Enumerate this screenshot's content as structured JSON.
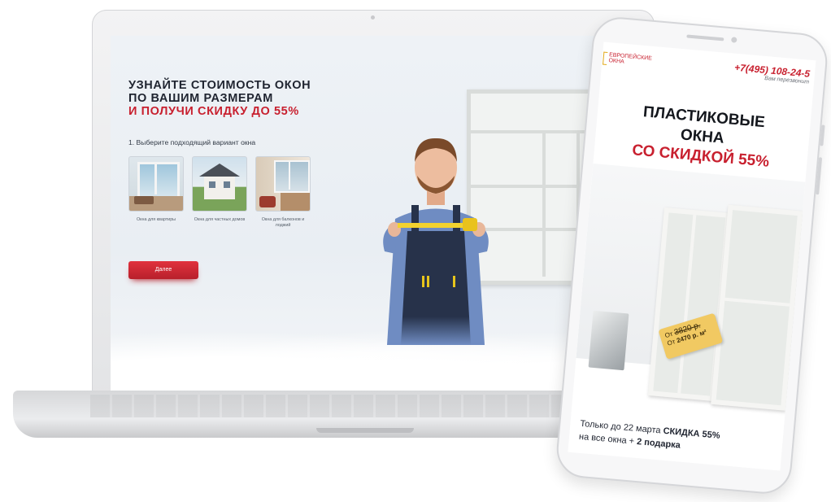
{
  "laptop": {
    "heading_line1": "УЗНАЙТЕ СТОИМОСТЬ ОКОН",
    "heading_line2": "ПО ВАШИМ РАЗМЕРАМ",
    "heading_line3": "И ПОЛУЧИ СКИДКУ ДО 55%",
    "step_label": "1. Выберите подходящий вариант окна",
    "options": [
      {
        "label": "Окна для квартиры"
      },
      {
        "label": "Окна для частных домов"
      },
      {
        "label": "Окна для балконов и лоджий"
      }
    ],
    "next_button": "Далее"
  },
  "phone": {
    "logo_line1": "ЕВРОПЕЙСКИЕ",
    "logo_line2": "ОКНА",
    "phone_number": "+7(495) 108-24-5",
    "callback": "Вам перезвонит",
    "title_line1": "ПЛАСТИКОВЫЕ",
    "title_line2": "ОКНА",
    "title_line3": "СО СКИДКОЙ 55%",
    "price_old_prefix": "От",
    "price_old": "3820 р.",
    "price_new_prefix": "От",
    "price_new": "2470 р. м²",
    "footer_line1_prefix": "Только до 22 марта ",
    "footer_line1_bold": "СКИДКА 55%",
    "footer_line2_prefix": "на все окна + ",
    "footer_line2_bold": "2 подарка"
  },
  "colors": {
    "accent_red": "#c8202f",
    "dark_text": "#1f2430",
    "tag_yellow": "#f1c962"
  }
}
